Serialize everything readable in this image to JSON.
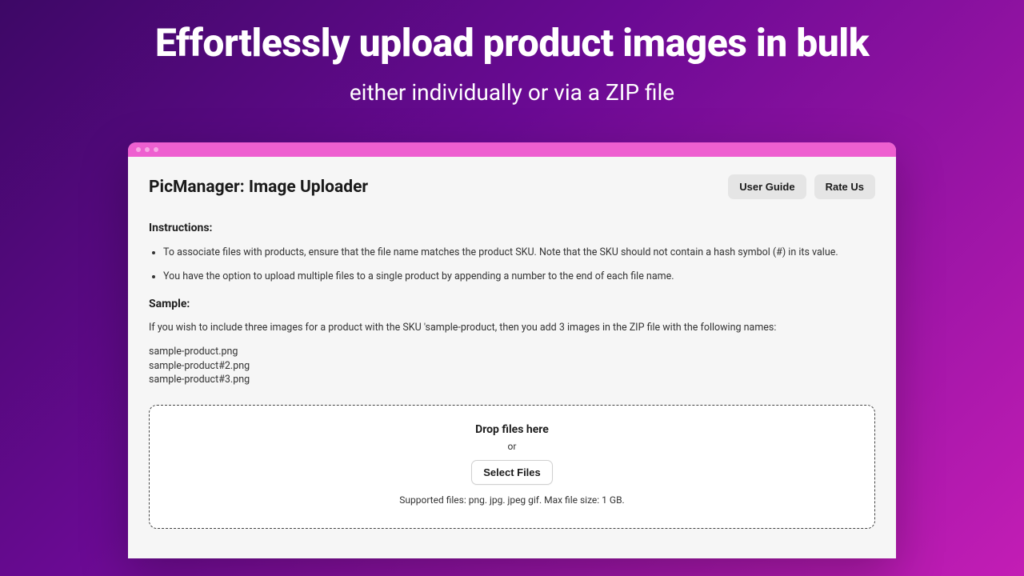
{
  "hero": {
    "title": "Effortlessly upload product images in bulk",
    "subtitle": "either individually or via a ZIP file"
  },
  "app": {
    "title": "PicManager: Image Uploader",
    "buttons": {
      "user_guide": "User Guide",
      "rate_us": "Rate Us"
    }
  },
  "instructions": {
    "heading": "Instructions:",
    "items": [
      "To associate files with products, ensure that the file name matches the product SKU. Note that the SKU should not contain a hash symbol (#) in its value.",
      "You have the option to upload multiple files to a single product by appending a number to the end of each file name."
    ]
  },
  "sample": {
    "heading": "Sample:",
    "intro": "If you wish to include three images for a product with the SKU 'sample-product, then you add 3 images in the ZIP file with the following names:",
    "files": [
      "sample-product.png",
      "sample-product#2.png",
      "sample-product#3.png"
    ]
  },
  "dropzone": {
    "title": "Drop files here",
    "or": "or",
    "select": "Select Files",
    "hint": "Supported files: png. jpg. jpeg gif. Max file size: 1 GB."
  }
}
